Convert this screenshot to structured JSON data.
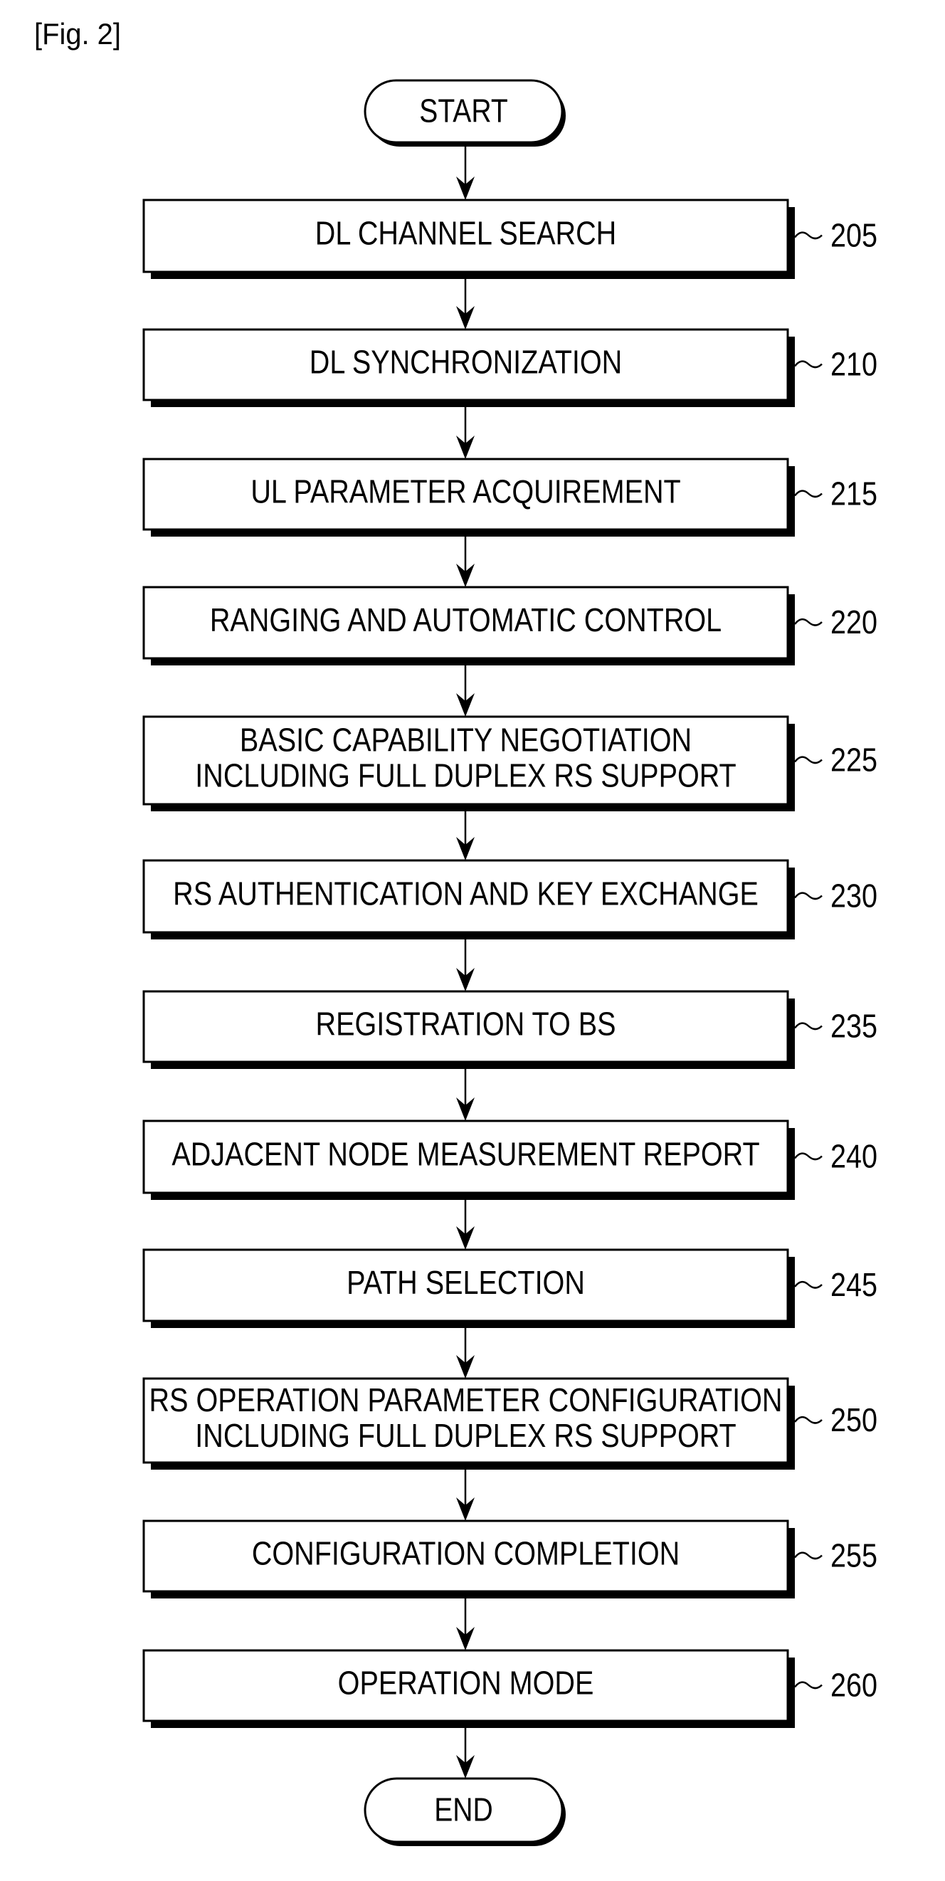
{
  "figure_label": "[Fig. 2]",
  "colors": {
    "stroke": "#000000",
    "fill": "#ffffff"
  },
  "start": {
    "label": "START"
  },
  "end": {
    "label": "END"
  },
  "steps": [
    {
      "ref": "205",
      "lines": [
        "DL CHANNEL SEARCH"
      ]
    },
    {
      "ref": "210",
      "lines": [
        "DL SYNCHRONIZATION"
      ]
    },
    {
      "ref": "215",
      "lines": [
        "UL PARAMETER ACQUIREMENT"
      ]
    },
    {
      "ref": "220",
      "lines": [
        "RANGING AND AUTOMATIC CONTROL"
      ]
    },
    {
      "ref": "225",
      "lines": [
        "BASIC CAPABILITY NEGOTIATION",
        "INCLUDING FULL DUPLEX RS SUPPORT"
      ]
    },
    {
      "ref": "230",
      "lines": [
        "RS AUTHENTICATION AND KEY EXCHANGE"
      ]
    },
    {
      "ref": "235",
      "lines": [
        "REGISTRATION TO BS"
      ]
    },
    {
      "ref": "240",
      "lines": [
        "ADJACENT NODE MEASUREMENT REPORT"
      ]
    },
    {
      "ref": "245",
      "lines": [
        "PATH SELECTION"
      ]
    },
    {
      "ref": "250",
      "lines": [
        "RS OPERATION PARAMETER CONFIGURATION",
        "INCLUDING FULL DUPLEX RS SUPPORT"
      ]
    },
    {
      "ref": "255",
      "lines": [
        "CONFIGURATION COMPLETION"
      ]
    },
    {
      "ref": "260",
      "lines": [
        "OPERATION MODE"
      ]
    }
  ]
}
